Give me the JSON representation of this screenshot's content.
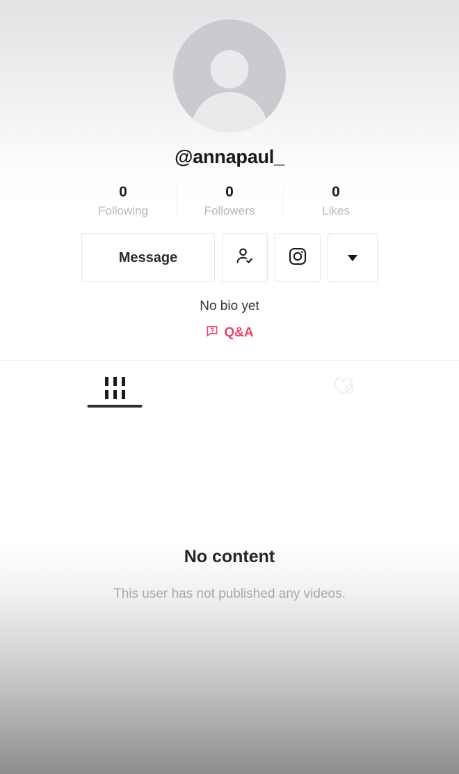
{
  "profile": {
    "username": "@annapaul_",
    "avatar_icon": "default-user-avatar-icon",
    "bio": "No bio yet",
    "qa_label": "Q&A",
    "qa_icon": "question-speech-bubble-icon"
  },
  "stats": [
    {
      "value": "0",
      "label": "Following"
    },
    {
      "value": "0",
      "label": "Followers"
    },
    {
      "value": "0",
      "label": "Likes"
    }
  ],
  "actions": {
    "message_label": "Message",
    "suggested_icon": "person-check-icon",
    "instagram_icon": "instagram-icon",
    "more_icon": "chevron-down-icon"
  },
  "tabs": [
    {
      "icon": "grid-videos-icon",
      "active": true
    },
    {
      "icon": "heart-slash-liked-hidden-icon",
      "active": false
    }
  ],
  "empty_state": {
    "title": "No content",
    "subtitle": "This user has not published any videos."
  },
  "colors": {
    "accent_qa": "#ef4567",
    "text_primary": "#161823",
    "text_muted": "#b8b8bb",
    "border": "#e4e4e6",
    "avatar_bg": "#c9cbce"
  }
}
